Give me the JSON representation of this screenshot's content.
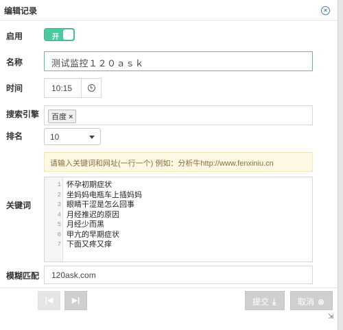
{
  "dialog": {
    "title": "编辑记录",
    "close_icon": "close-icon"
  },
  "form": {
    "enabled": {
      "label": "启用",
      "toggle_text": "开",
      "on": true
    },
    "name": {
      "label": "名称",
      "value": "测试监控１２０ａｓｋ"
    },
    "time": {
      "label": "时间",
      "value": "10:15",
      "icon": "clock-icon"
    },
    "search_engine": {
      "label": "搜索引擎",
      "tags": [
        "百度"
      ],
      "remove_glyph": "×"
    },
    "rank": {
      "label": "排名",
      "selected": "10"
    },
    "keywords": {
      "label": "关键词",
      "hint": "请输入关键词和网址(一行一个)   例如：分析牛http://www.fenxiniu.cn",
      "line_numbers": [
        "1",
        "2",
        "3",
        "4",
        "5",
        "6",
        "7"
      ],
      "lines": [
        "怀孕初期症状",
        "坐妈妈电瓶车上插妈妈",
        "眼睛干涩是怎么回事",
        "月经推迟的原因",
        "月经少而黑",
        "甲亢的早期症状",
        "下面又疼又痒"
      ]
    },
    "fuzzy_match": {
      "label": "模糊匹配",
      "value": "120ask.com"
    }
  },
  "footer": {
    "prev_icon": "first-page-icon",
    "next_icon": "last-page-icon",
    "submit_label": "提交",
    "submit_icon": "download-icon",
    "cancel_label": "取消",
    "cancel_icon": "close-circle-icon"
  },
  "colors": {
    "toggle_on": "#4cc9a0",
    "focus_border": "#5bbf9e",
    "hint_bg": "#fcf8e3",
    "hint_text": "#8a6d3b",
    "close_blue": "#3a7dc4",
    "button_gray": "#cfcfcf"
  }
}
